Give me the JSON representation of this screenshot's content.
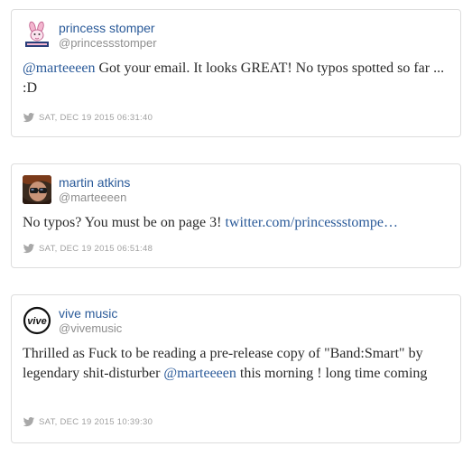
{
  "tweets": [
    {
      "name": "princess stomper",
      "handle": "@princessstomper",
      "avatar_icon": "princess-stomper-bunny-logo",
      "text_parts": [
        {
          "type": "mention",
          "text": "@marteeeen"
        },
        {
          "type": "text",
          "text": " Got your email. It looks GREAT! No typos spotted so far ... :D"
        }
      ],
      "timestamp": "SAT, DEC 19 2015 06:31:40"
    },
    {
      "name": "martin atkins",
      "handle": "@marteeeen",
      "avatar_icon": "martin-atkins-photo",
      "text_parts": [
        {
          "type": "text",
          "text": "No typos? You must be on page 3! "
        },
        {
          "type": "link",
          "text": "twitter.com/princessstompe…"
        }
      ],
      "timestamp": "SAT, DEC 19 2015 06:51:48"
    },
    {
      "name": "vive music",
      "handle": "@vivemusic",
      "avatar_icon": "vive-logo",
      "avatar_text": "vive",
      "text_parts": [
        {
          "type": "text",
          "text": "Thrilled as Fuck to be reading a pre-release copy of \"Band:Smart\" by legendary shit-disturber "
        },
        {
          "type": "mention",
          "text": "@marteeeen"
        },
        {
          "type": "text",
          "text": " this morning ! long time coming"
        }
      ],
      "timestamp": "SAT, DEC 19 2015 10:39:30"
    }
  ],
  "colors": {
    "link": "#2a5a99",
    "meta": "#a0a0a0",
    "border": "#dddddd"
  },
  "icons": {
    "source": "twitter-bird-icon"
  }
}
